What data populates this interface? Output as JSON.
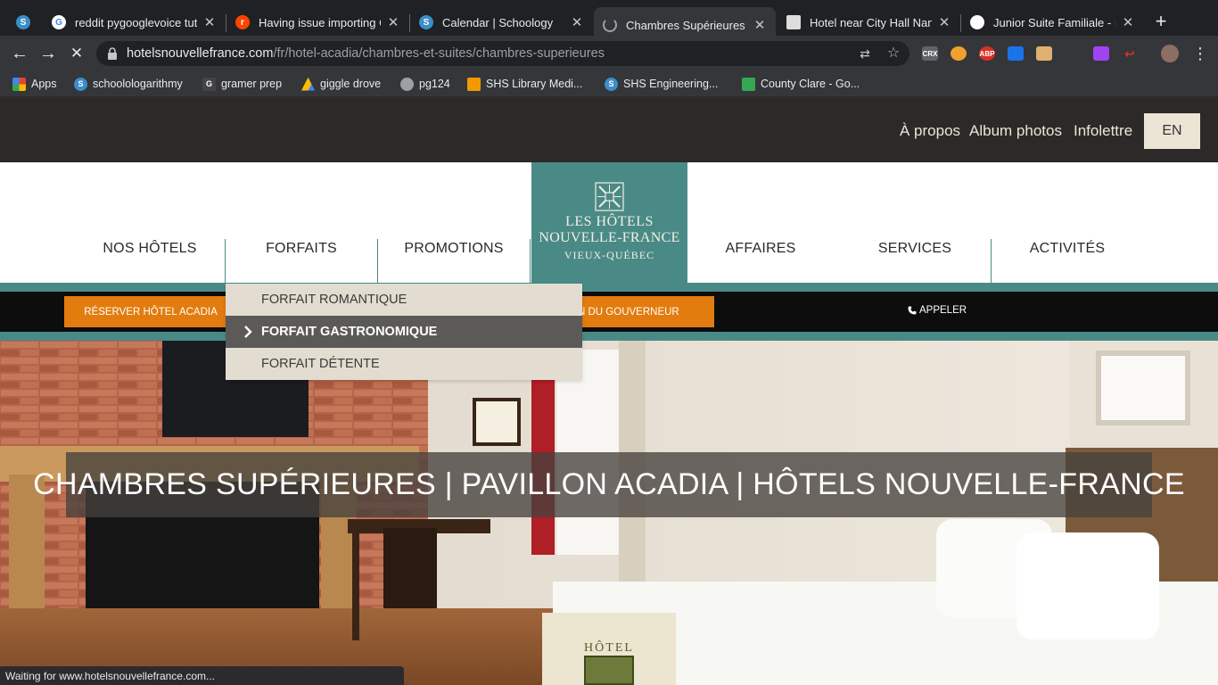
{
  "browser": {
    "tabs": [
      {
        "title": "",
        "favicon": "schoology-icon",
        "color": "#3a8ec9"
      },
      {
        "title": "reddit pygooglevoice tuto",
        "favicon": "google-icon",
        "color": "#ffffff"
      },
      {
        "title": "Having issue importing G",
        "favicon": "reddit-icon",
        "color": "#ff4500"
      },
      {
        "title": "Calendar | Schoology",
        "favicon": "schoology-icon",
        "color": "#3a8ec9"
      },
      {
        "title": "Chambres Supérieures |",
        "favicon": "loading-icon",
        "color": "#35363a",
        "active": true
      },
      {
        "title": "Hotel near City Hall Nant",
        "favicon": "page-icon",
        "color": "#dddddd"
      },
      {
        "title": "Junior Suite Familiale - H",
        "favicon": "hotel-icon",
        "color": "#ffffff"
      }
    ],
    "url_host": "hotelsnouvellefrance.com",
    "url_path": "/fr/hotel-acadia/chambres-et-suites/chambres-superieures",
    "extensions": [
      "CRX",
      "owl",
      "ABP",
      "wave",
      "box",
      "",
      "color",
      "arrow"
    ],
    "bookmarks": [
      {
        "label": "Apps",
        "icon": "apps-grid-icon",
        "color": "#e94235"
      },
      {
        "label": "schoolologarithmy",
        "icon": "schoology-icon",
        "color": "#3a8ec9"
      },
      {
        "label": "gramer prep",
        "icon": "gb-icon",
        "color": "#444444"
      },
      {
        "label": "giggle drove",
        "icon": "drive-icon",
        "color": "#fbbc04"
      },
      {
        "label": "pg124",
        "icon": "globe-icon",
        "color": "#9aa0a6"
      },
      {
        "label": "SHS Library Medi...",
        "icon": "library-icon",
        "color": "#f29900"
      },
      {
        "label": "SHS Engineering...",
        "icon": "schoology-icon",
        "color": "#3a8ec9"
      },
      {
        "label": "County Clare - Go...",
        "icon": "maps-icon",
        "color": "#34a853"
      }
    ],
    "status_text": "Waiting for www.hotelsnouvellefrance.com..."
  },
  "site": {
    "top_links": [
      "À propos",
      "Album photos",
      "Infolettre"
    ],
    "lang_button": "EN",
    "nav": [
      "NOS HÔTELS",
      "FORFAITS",
      "PROMOTIONS",
      "AFFAIRES",
      "SERVICES",
      "ACTIVITÉS"
    ],
    "logo": {
      "line1": "LES HÔTELS",
      "line2": "NOUVELLE-FRANCE",
      "line3": "VIEUX-QUÉBEC"
    },
    "book_acadia": "RÉSERVER HÔTEL ACADIA",
    "book_gouverneur": "N DU GOUVERNEUR",
    "call": "APPELER",
    "dropdown": [
      "FORFAIT ROMANTIQUE",
      "FORFAIT GASTRONOMIQUE",
      "FORFAIT DÉTENTE"
    ],
    "hero_title": "CHAMBRES SUPÉRIEURES | PAVILLON ACADIA | HÔTELS NOUVELLE-FRANCE",
    "hotel_badge": "HÔTEL",
    "colors": {
      "teal": "#4a8a86",
      "orange": "#e27c0e",
      "dark": "#2b2a29",
      "cream": "#ece5d5"
    }
  }
}
